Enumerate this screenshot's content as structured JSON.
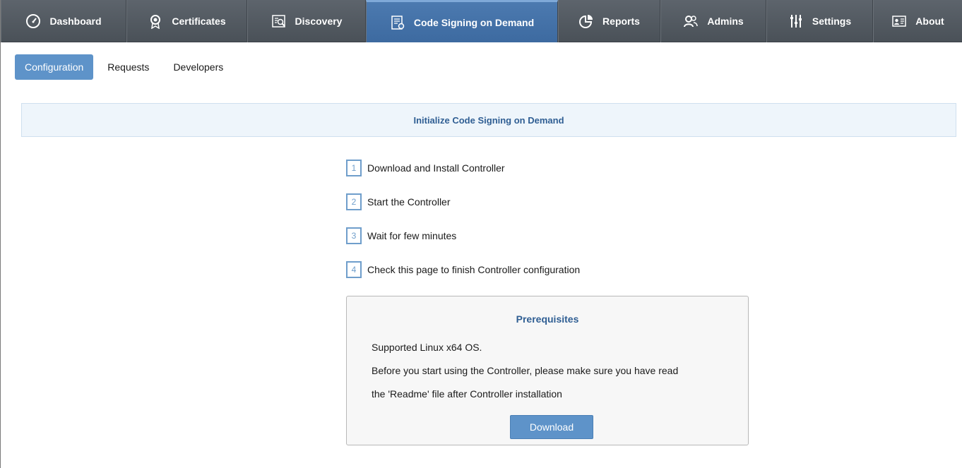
{
  "nav": {
    "items": [
      {
        "label": "Dashboard",
        "icon": "gauge-icon"
      },
      {
        "label": "Certificates",
        "icon": "certificate-badge-icon"
      },
      {
        "label": "Discovery",
        "icon": "discovery-icon"
      },
      {
        "label": "Code Signing on Demand",
        "icon": "code-signing-icon",
        "active": true
      },
      {
        "label": "Reports",
        "icon": "pie-chart-icon"
      },
      {
        "label": "Admins",
        "icon": "admins-icon"
      },
      {
        "label": "Settings",
        "icon": "sliders-icon"
      },
      {
        "label": "About",
        "icon": "id-card-icon"
      }
    ]
  },
  "subtabs": {
    "configuration": "Configuration",
    "requests": "Requests",
    "developers": "Developers"
  },
  "banner": {
    "title": "Initialize Code Signing on Demand"
  },
  "steps": [
    {
      "num": "1",
      "text": "Download and Install Controller"
    },
    {
      "num": "2",
      "text": "Start the Controller"
    },
    {
      "num": "3",
      "text": "Wait for few minutes"
    },
    {
      "num": "4",
      "text": "Check this page to finish Controller configuration"
    }
  ],
  "prereq": {
    "title": "Prerequisites",
    "line1": "Supported Linux x64 OS.",
    "line2": "Before you start using the Controller, please make sure you have read",
    "line3": "the 'Readme' file after Controller installation",
    "download_label": "Download"
  },
  "colors": {
    "accent": "#5e93c9",
    "nav_bg": "#535a62",
    "title_blue": "#2f5e93"
  }
}
